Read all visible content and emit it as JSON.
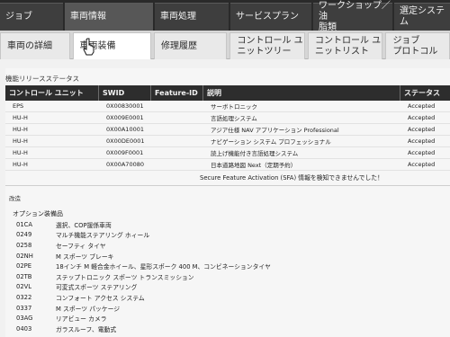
{
  "nav1": {
    "tabs": [
      {
        "label": "ジョブ"
      },
      {
        "label": "車両情報"
      },
      {
        "label": "車両処理"
      },
      {
        "label": "サービスプラン"
      },
      {
        "label": "ワークショップ／油\n脂類"
      },
      {
        "label": "選定システム"
      }
    ]
  },
  "nav2": {
    "tabs": [
      {
        "label": "車両の詳細"
      },
      {
        "label": "車両装備"
      },
      {
        "label": "修理履歴"
      },
      {
        "label": "コントロール ユ\nニットツリー"
      },
      {
        "label": "コントロール ユ\nニットリスト"
      },
      {
        "label": "ジョブ\nプロトコル"
      }
    ]
  },
  "release_status": {
    "title": "機能リリースステータス",
    "columns": [
      "コントロール ユニット",
      "SWID",
      "Feature-ID",
      "説明",
      "ステータス"
    ],
    "rows": [
      {
        "unit": "EPS",
        "swid": "0X00830001",
        "feature": "",
        "desc": "サーボトロニック",
        "status": "Accepted"
      },
      {
        "unit": "HU-H",
        "swid": "0X009E0001",
        "feature": "",
        "desc": "言語処理システム",
        "status": "Accepted"
      },
      {
        "unit": "HU-H",
        "swid": "0X00A10001",
        "feature": "",
        "desc": "アジア仕様 NAV アプリケーション Professional",
        "status": "Accepted"
      },
      {
        "unit": "HU-H",
        "swid": "0X00DE0001",
        "feature": "",
        "desc": "ナビゲーション システム プロフェッショナル",
        "status": "Accepted"
      },
      {
        "unit": "HU-H",
        "swid": "0X009F0001",
        "feature": "",
        "desc": "読上げ機能付き言語処理システム",
        "status": "Accepted"
      },
      {
        "unit": "HU-H",
        "swid": "0X00A70080",
        "feature": "",
        "desc": "日本道路地図 Next（定期予約）",
        "status": "Accepted"
      }
    ],
    "sfa_message": "Secure Feature Activation (SFA) 情報を検知できませんでした！"
  },
  "remarks": "改造",
  "options": {
    "title": "オプション装備品",
    "items": [
      {
        "code": "01CA",
        "desc": "選択、COP援係車両"
      },
      {
        "code": "0249",
        "desc": "マルチ機能ステアリング ホィール"
      },
      {
        "code": "0258",
        "desc": "セーフティ タイヤ"
      },
      {
        "code": "02NH",
        "desc": "M スポーツ ブレーキ"
      },
      {
        "code": "02PE",
        "desc": "18インチ M 軽合金ホイール、星形スポーク 400 M、コンビネーションタイヤ"
      },
      {
        "code": "02TB",
        "desc": "ステップトロニック スポーツ トランスミッション"
      },
      {
        "code": "02VL",
        "desc": "可変式スポーツ ステアリング"
      },
      {
        "code": "0322",
        "desc": "コンフォート アクセス システム"
      },
      {
        "code": "0337",
        "desc": "M スポーツ パッケージ"
      },
      {
        "code": "03AG",
        "desc": "リアビュー カメラ"
      },
      {
        "code": "0403",
        "desc": "ガラスルーフ、電動式"
      }
    ]
  }
}
